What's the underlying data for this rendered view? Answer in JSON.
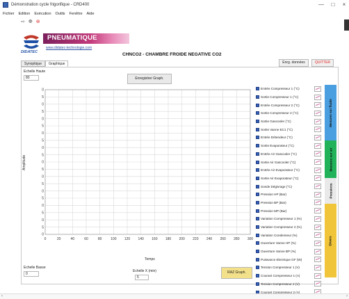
{
  "window": {
    "title": "Démonstration cycle frigorifique - CRD400",
    "minimize": "—",
    "maximize": "□",
    "close": "×"
  },
  "menu": [
    "Fichier",
    "Edition",
    "Exécution",
    "Outils",
    "Fenêtre",
    "Aide"
  ],
  "toolbar": [
    "⇨",
    "❁",
    "⊛"
  ],
  "brand": {
    "name": "PNEUMATIQUE",
    "url": "www.didatec-technologie.com",
    "company": "DIDATEC"
  },
  "header": {
    "title": "CHNCO2 - CHAMBRE FROIDE NEGATIVE CO2",
    "save_data": "Enrg. données",
    "quit": "QUITTER"
  },
  "tabs": [
    "Synoptique",
    "Graphique"
  ],
  "controls": {
    "echelle_haute_label": "Echelle Haute",
    "echelle_haute_value": "80",
    "enregistrer": "Enregistrer Graph.",
    "echelle_basse_label": "Echelle Basse",
    "echelle_basse_value": "0",
    "echelle_x_label": "Echelle X (min)",
    "echelle_x_value": "5",
    "raz": "RAZ Graph."
  },
  "chart_data": {
    "type": "line",
    "xlabel": "Temps",
    "ylabel": "Amplitude",
    "xlim": [
      0,
      300
    ],
    "ylim": [
      0,
      100
    ],
    "x_ticks": [
      0,
      20,
      40,
      60,
      80,
      100,
      120,
      140,
      160,
      180,
      200,
      220,
      240,
      260,
      280,
      300
    ],
    "y_ticks": [
      0,
      5,
      10,
      15,
      20,
      25,
      30,
      35,
      40,
      45,
      50,
      55,
      60,
      65,
      70,
      75,
      80,
      85,
      90,
      95,
      100
    ],
    "grid": true,
    "series": []
  },
  "legend": [
    "Entrée Compresseur 1 (°C)",
    "Sortie Compresseur 1 (°C)",
    "Entrée Compresseur 2 (°C)",
    "Sortie Compresseur 2 (°C)",
    "Sortie Gascooler (°C)",
    "Sortie Vanne EC1 (°C)",
    "Entrée Détendeur (°C)",
    "Sortie Evaporateur (°C)",
    "Entrée Air Gascooler (°C)",
    "Sortie Air Gascooler (°C)",
    "Entrée Air Evaporateur (°C)",
    "Sortie Air Evaporateur (°C)",
    "Sonde Dégivrage (°C)",
    "Pression HP (Bar)",
    "Pression BP (Bar)",
    "Pression MP (Bar)",
    "Variation Compresseur 1 (%)",
    "Variation Compresseur 2 (%)",
    "Variation Condenseur (%)",
    "Ouverture Vanne HP (%)",
    "Ouverture Vanne BP (%)",
    "Puissance Electrique GF (W)",
    "Tension Compresseur 1 (V)",
    "Courant Compresseur 1 (A)",
    "Tension Compresseur 2 (V)",
    "Courant Compresseur 2 (A)"
  ],
  "groups": [
    {
      "label": "Mesures sur fluide",
      "color": "#4a9fe0"
    },
    {
      "label": "Mesures sur air",
      "color": "#21b25a"
    },
    {
      "label": "Pressions",
      "color": "#e9e9e9"
    },
    {
      "label": "Divers",
      "color": "#f0c53a"
    }
  ],
  "colors": {
    "grid": "#d9d9d9",
    "legend_swatch": "#3a62b8",
    "raz_button": "#f3e08a"
  }
}
